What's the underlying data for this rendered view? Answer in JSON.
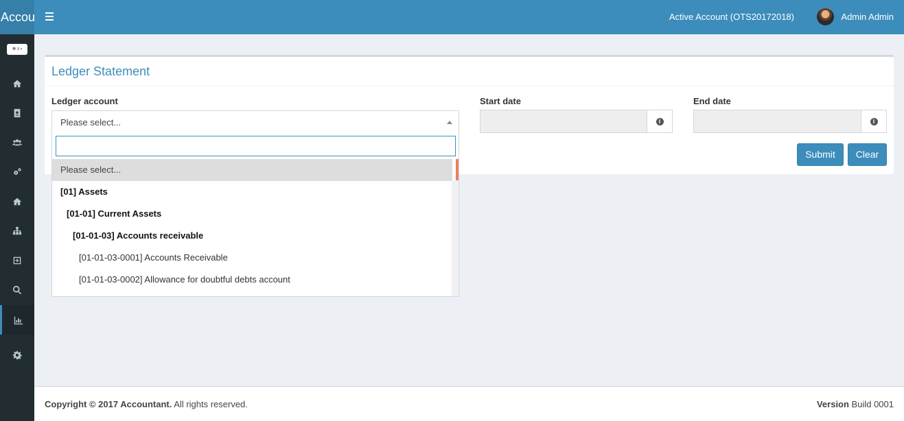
{
  "app": {
    "logo_text": "Accou"
  },
  "header": {
    "active_account": "Active Account (OTS20172018)",
    "user_name": "Admin Admin"
  },
  "sidebar": {
    "brand_text": "☸ ≡ ▪",
    "items": [
      {
        "icon": "home-icon"
      },
      {
        "icon": "address-book-icon"
      },
      {
        "icon": "users-icon"
      },
      {
        "icon": "cogs-icon"
      },
      {
        "icon": "home-icon"
      },
      {
        "icon": "sitemap-icon"
      },
      {
        "icon": "plus-square-icon"
      },
      {
        "icon": "search-icon"
      },
      {
        "icon": "bar-chart-icon",
        "active": true
      },
      {
        "icon": "gear-icon"
      }
    ]
  },
  "page": {
    "title": "Ledger Statement",
    "ledger_label": "Ledger account",
    "ledger_selected": "Please select...",
    "start_label": "Start date",
    "end_label": "End date",
    "submit_label": "Submit",
    "clear_label": "Clear"
  },
  "dropdown": {
    "options": [
      "Please select...",
      "[01] Assets",
      "[01-01] Current Assets",
      "[01-01-03] Accounts receivable",
      "[01-01-03-0001] Accounts Receivable",
      "[01-01-03-0002] Allowance for doubtful debts account"
    ]
  },
  "footer": {
    "copyright_bold": "Copyright © 2017 Accountant.",
    "copyright_rest": " All rights reserved.",
    "version_label": "Version",
    "version_value": " Build 0001"
  }
}
